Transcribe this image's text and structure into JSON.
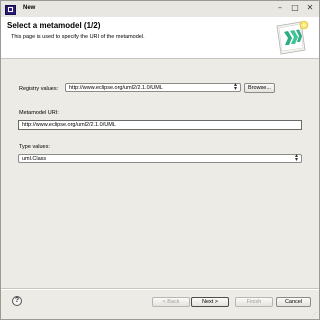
{
  "window": {
    "title": "New",
    "min_glyph": "–",
    "max_glyph": "□",
    "close_glyph": "✕"
  },
  "banner": {
    "title": "Select a metamodel (1/2)",
    "description": "This page is used to specify the URI of the metamodel.",
    "icon": "wizard-banner-icon"
  },
  "form": {
    "registry_label": "Registry values:",
    "registry_value": "http://www.eclipse.org/uml2/2.1.0/UML",
    "browse_label": "Browse...",
    "metamodel_uri_label": "Metamodel URI:",
    "metamodel_uri_value": "http://www.eclipse.org/uml2/2.1.0/UML",
    "type_values_label": "Type values:",
    "type_value": "uml.Class"
  },
  "footer": {
    "help_glyph": "?",
    "back_label": "< Back",
    "next_label": "Next >",
    "finish_label": "Finish",
    "cancel_label": "Cancel"
  },
  "colors": {
    "window_bg": "#ecebe6",
    "banner_bg": "#ffffff",
    "icon_green": "#2fae86"
  }
}
